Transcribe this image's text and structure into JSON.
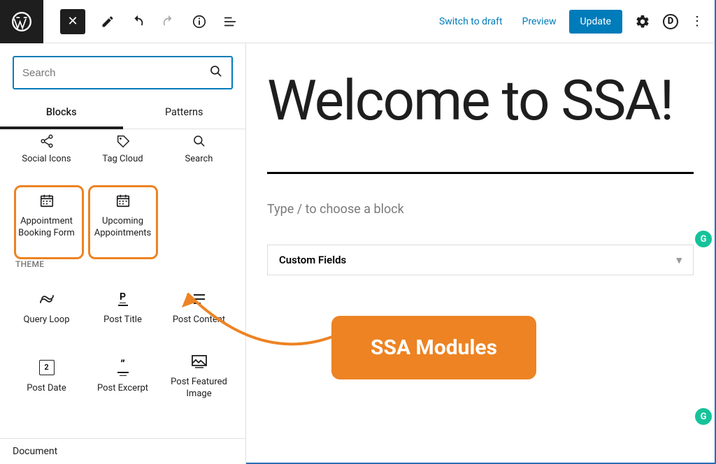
{
  "topbar": {
    "switch_to_draft": "Switch to draft",
    "preview": "Preview",
    "update": "Update"
  },
  "sidebar": {
    "search_placeholder": "Search",
    "tabs": {
      "blocks": "Blocks",
      "patterns": "Patterns"
    },
    "row1": [
      {
        "label": "Social Icons",
        "icon": "share"
      },
      {
        "label": "Tag Cloud",
        "icon": "tag"
      },
      {
        "label": "Search",
        "icon": "search"
      }
    ],
    "ssa": [
      {
        "label": "Appointment Booking Form",
        "icon": "calendar"
      },
      {
        "label": "Upcoming Appointments",
        "icon": "calendar"
      }
    ],
    "section_theme": "THEME",
    "theme_row1": [
      {
        "label": "Query Loop",
        "icon": "loop"
      },
      {
        "label": "Post Title",
        "icon": "ptitle"
      },
      {
        "label": "Post Content",
        "icon": "content"
      }
    ],
    "theme_row2": [
      {
        "label": "Post Date",
        "icon": "date"
      },
      {
        "label": "Post Excerpt",
        "icon": "excerpt"
      },
      {
        "label": "Post Featured Image",
        "icon": "fimage"
      }
    ],
    "document": "Document"
  },
  "editor": {
    "title": "Welcome to SSA!",
    "placeholder": "Type / to choose a block",
    "custom_fields": "Custom Fields"
  },
  "callout": "SSA Modules",
  "icons": {
    "share": "⤳",
    "tag": "⬡",
    "search": "⚲",
    "calendar": "Ὄ5",
    "loop": "∞",
    "ptitle": "P",
    "content": "≡",
    "date": "2",
    "excerpt": "”",
    "fimage": "▣"
  }
}
